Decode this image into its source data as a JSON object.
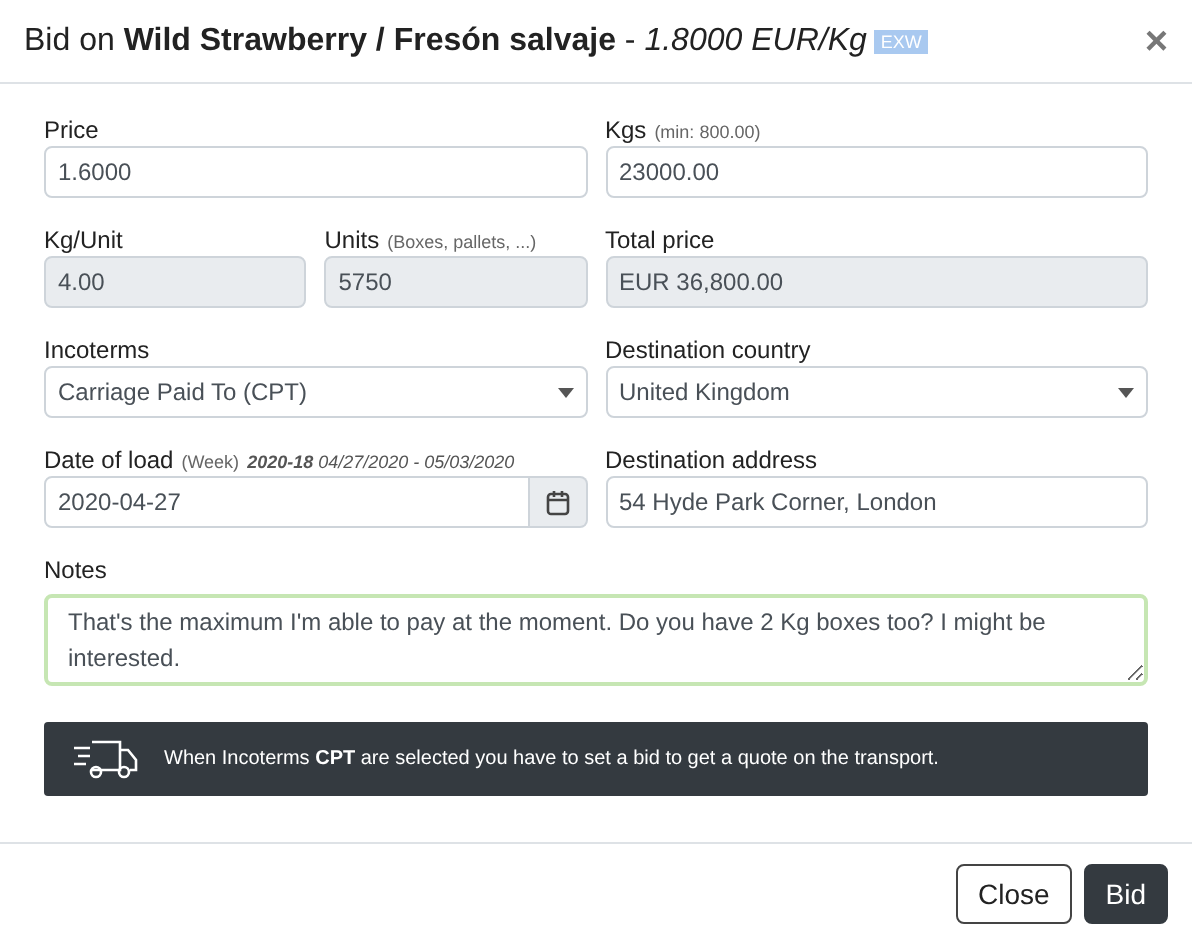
{
  "dialog": {
    "title": "Bid on **Wild Strawberry / Fresón salvaje** - *1.8000 EUR/Kg*",
    "badge": "EXW",
    "close_icon": "×"
  },
  "rows": [
    [
      {
        "kind": "text",
        "label": "Price",
        "value": "1.6000",
        "readonly": false
      },
      {
        "kind": "text",
        "label": "Kgs",
        "hint": "(min: 800.00)",
        "value": "23000.00",
        "readonly": false
      }
    ],
    [
      {
        "kind": "text",
        "label": "Kg/Unit",
        "value": "4.00",
        "readonly": true
      },
      {
        "kind": "text",
        "label": "Units",
        "hint": "(Boxes, pallets, ...)",
        "value": "5750",
        "readonly": true
      },
      {
        "kind": "text",
        "label": "Total price",
        "value": "EUR 36,800.00",
        "readonly": true
      }
    ],
    [
      {
        "kind": "select",
        "label": "Incoterms",
        "value": "Carriage Paid To (CPT)",
        "readonly": false
      },
      {
        "kind": "select",
        "label": "Destination country",
        "value": "United Kingdom",
        "readonly": false
      }
    ],
    [
      {
        "kind": "date",
        "label": "Date of load",
        "hint": "(Week)",
        "week": "**2020-18** 04/27/2020 - 05/03/2020",
        "value": "2020-04-27",
        "readonly": false
      },
      {
        "kind": "text",
        "label": "Destination address",
        "value": "54 Hyde Park Corner, London",
        "readonly": false
      }
    ]
  ],
  "notes": {
    "label": "Notes",
    "value": "That's the maximum I'm able to pay at the moment. Do you have 2 Kg boxes too? I might be interested.",
    "focused": true
  },
  "notice": "When Incoterms **CPT** are selected you have to set a bid to get a quote on the transport.",
  "buttons": [
    {
      "label": "Close",
      "primary": false
    },
    {
      "label": "Bid",
      "primary": true
    }
  ]
}
